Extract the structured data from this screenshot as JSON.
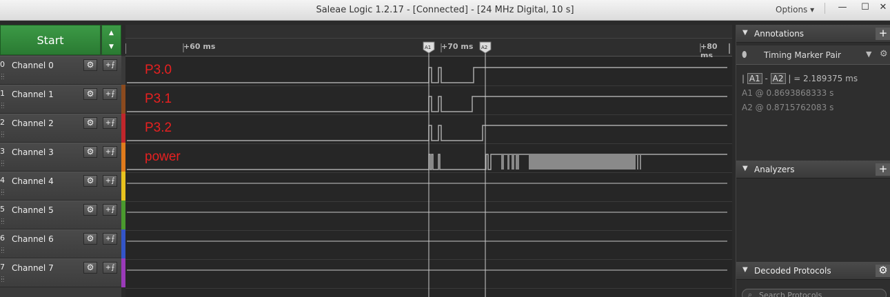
{
  "window": {
    "title": "Saleae Logic 1.2.17 - [Connected] - [24 MHz Digital, 10 s]",
    "options_label": "Options ▾"
  },
  "controls": {
    "start_label": "Start"
  },
  "channels": [
    {
      "index": "0",
      "name": "Channel 0",
      "color": "#3a3a3a",
      "annotation": "P3.0"
    },
    {
      "index": "1",
      "name": "Channel 1",
      "color": "#8b4a1e",
      "annotation": "P3.1"
    },
    {
      "index": "2",
      "name": "Channel 2",
      "color": "#c0262b",
      "annotation": "P3.2"
    },
    {
      "index": "3",
      "name": "Channel 3",
      "color": "#e07b1c",
      "annotation": "power"
    },
    {
      "index": "4",
      "name": "Channel 4",
      "color": "#e8c21e",
      "annotation": ""
    },
    {
      "index": "5",
      "name": "Channel 5",
      "color": "#4a9a2e",
      "annotation": ""
    },
    {
      "index": "6",
      "name": "Channel 6",
      "color": "#3355c8",
      "annotation": ""
    },
    {
      "index": "7",
      "name": "Channel 7",
      "color": "#9a3ab8",
      "annotation": ""
    }
  ],
  "timeline": {
    "ticks": [
      "+60 ms",
      "+70 ms",
      "+80 ms"
    ],
    "marker_a1": "A1",
    "marker_a2": "A2"
  },
  "annotations_panel": {
    "title": "Annotations",
    "marker_pair_label": "Timing Marker Pair",
    "delta_label": "| A1 - A2 | = 2.189375 ms",
    "delta_value": "= 2.189375 ms",
    "a1_label": "A1",
    "a1_value": "@  0.8693868333 s",
    "a2_label": "A2",
    "a2_value": "@  0.8715762083 s"
  },
  "analyzers_panel": {
    "title": "Analyzers"
  },
  "decoded_panel": {
    "title": "Decoded Protocols",
    "search_placeholder": "Search Protocols"
  }
}
